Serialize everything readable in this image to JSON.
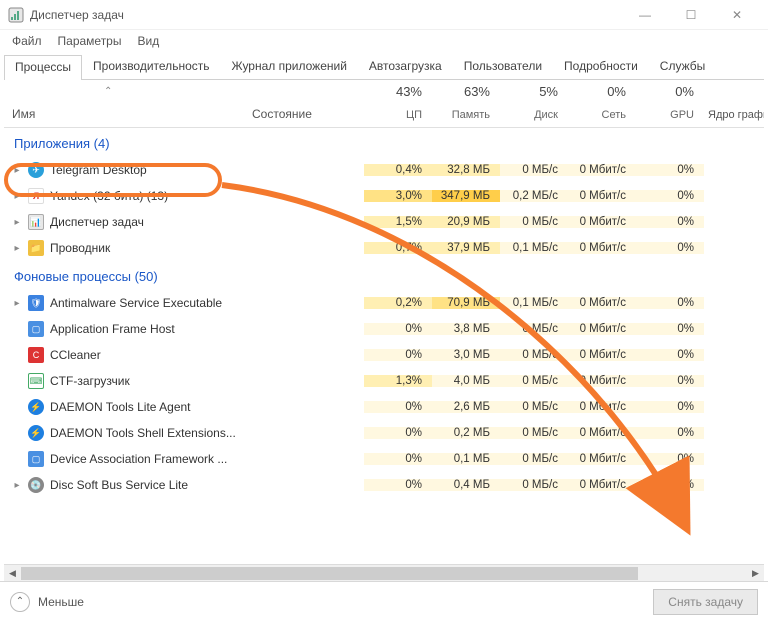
{
  "window": {
    "title": "Диспетчер задач"
  },
  "menu": {
    "file": "Файл",
    "options": "Параметры",
    "view": "Вид"
  },
  "tabs": {
    "processes": "Процессы",
    "performance": "Производительность",
    "apphistory": "Журнал приложений",
    "startup": "Автозагрузка",
    "users": "Пользователи",
    "details": "Подробности",
    "services": "Службы"
  },
  "columns": {
    "name": "Имя",
    "status": "Состояние",
    "cpu_pc": "43%",
    "cpu_lbl": "ЦП",
    "mem_pc": "63%",
    "mem_lbl": "Память",
    "disk_pc": "5%",
    "disk_lbl": "Диск",
    "net_pc": "0%",
    "net_lbl": "Сеть",
    "gpu_pc": "0%",
    "gpu_lbl": "GPU",
    "extra": "Ядро графиче"
  },
  "groups": {
    "apps": "Приложения (4)",
    "bg": "Фоновые процессы (50)"
  },
  "rows": {
    "telegram": {
      "name": "Telegram Desktop",
      "cpu": "0,4%",
      "mem": "32,8 МБ",
      "disk": "0 МБ/с",
      "net": "0 Мбит/с",
      "gpu": "0%"
    },
    "yandex": {
      "name": "Yandex (32 бита) (13)",
      "cpu": "3,0%",
      "mem": "347,9 МБ",
      "disk": "0,2 МБ/с",
      "net": "0 Мбит/с",
      "gpu": "0%"
    },
    "taskmgr": {
      "name": "Диспетчер задач",
      "cpu": "1,5%",
      "mem": "20,9 МБ",
      "disk": "0 МБ/с",
      "net": "0 Мбит/с",
      "gpu": "0%"
    },
    "explorer": {
      "name": "Проводник",
      "cpu": "0,7%",
      "mem": "37,9 МБ",
      "disk": "0,1 МБ/с",
      "net": "0 Мбит/с",
      "gpu": "0%"
    },
    "antimal": {
      "name": "Antimalware Service Executable",
      "cpu": "0,2%",
      "mem": "70,9 МБ",
      "disk": "0,1 МБ/с",
      "net": "0 Мбит/с",
      "gpu": "0%"
    },
    "afh": {
      "name": "Application Frame Host",
      "cpu": "0%",
      "mem": "3,8 МБ",
      "disk": "0 МБ/с",
      "net": "0 Мбит/с",
      "gpu": "0%"
    },
    "ccleaner": {
      "name": "CCleaner",
      "cpu": "0%",
      "mem": "3,0 МБ",
      "disk": "0 МБ/с",
      "net": "0 Мбит/с",
      "gpu": "0%"
    },
    "ctf": {
      "name": "CTF-загрузчик",
      "cpu": "1,3%",
      "mem": "4,0 МБ",
      "disk": "0 МБ/с",
      "net": "0 Мбит/с",
      "gpu": "0%"
    },
    "dtla": {
      "name": "DAEMON Tools Lite Agent",
      "cpu": "0%",
      "mem": "2,6 МБ",
      "disk": "0 МБ/с",
      "net": "0 Мбит/с",
      "gpu": "0%"
    },
    "dtse": {
      "name": "DAEMON Tools Shell Extensions...",
      "cpu": "0%",
      "mem": "0,2 МБ",
      "disk": "0 МБ/с",
      "net": "0 Мбит/с",
      "gpu": "0%"
    },
    "daf": {
      "name": "Device Association Framework ...",
      "cpu": "0%",
      "mem": "0,1 МБ",
      "disk": "0 МБ/с",
      "net": "0 Мбит/с",
      "gpu": "0%"
    },
    "dsbsl": {
      "name": "Disc Soft Bus Service Lite",
      "cpu": "0%",
      "mem": "0,4 МБ",
      "disk": "0 МБ/с",
      "net": "0 Мбит/с",
      "gpu": "0%"
    }
  },
  "footer": {
    "less": "Меньше",
    "endtask": "Снять задачу"
  }
}
